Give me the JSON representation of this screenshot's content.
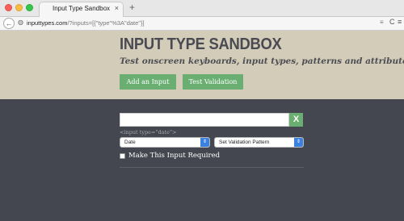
{
  "browser": {
    "tab_title": "Input Type Sandbox",
    "tab_close": "×",
    "new_tab": "+",
    "back": "←",
    "url_domain": "inputtypes.com",
    "url_path": "/?inputs=[{\"type\"%3A\"date\"}]",
    "reader": "≡",
    "reload": "C",
    "menu": "≡"
  },
  "hero": {
    "title": "INPUT TYPE SANDBOX",
    "subtitle": "Test onscreen keyboards, input types, patterns and attributes.",
    "add_button": "Add an Input",
    "test_button": "Test Validation"
  },
  "form": {
    "input_value": "",
    "clear_label": "X",
    "input_tag": "<input type=\"date\">",
    "type_select": "Date",
    "pattern_select": "Set Validation Pattern",
    "required_label": "Make This Input Required"
  }
}
